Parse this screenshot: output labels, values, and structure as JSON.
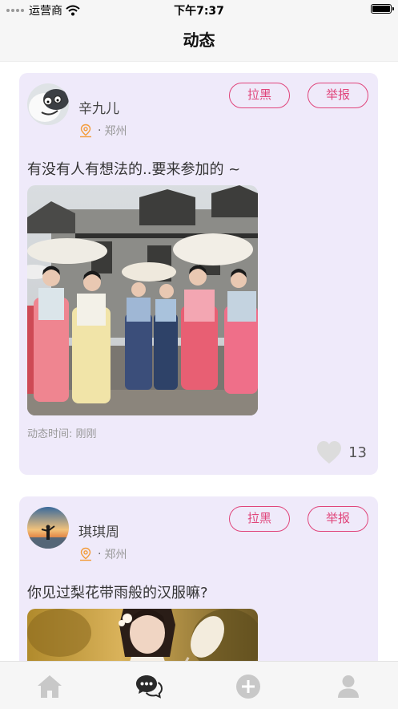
{
  "status_bar": {
    "carrier": "运营商",
    "time": "下午7:37"
  },
  "nav": {
    "title": "动态"
  },
  "posts": [
    {
      "username": "辛九儿",
      "location_separator": "·",
      "location": "郑州",
      "block_label": "拉黑",
      "report_label": "举报",
      "content": "有没有人有想法的..要来参加的 ~",
      "time_label": "动态时间: 刚刚",
      "likes": "13"
    },
    {
      "username": "琪琪周",
      "location_separator": "·",
      "location": "郑州",
      "block_label": "拉黑",
      "report_label": "举报",
      "content": "你见过梨花带雨般的汉服嘛?"
    }
  ],
  "tab_bar": {
    "tabs": [
      {
        "icon": "home-icon",
        "active": false
      },
      {
        "icon": "chat-icon",
        "active": true
      },
      {
        "icon": "add-icon",
        "active": false
      },
      {
        "icon": "profile-icon",
        "active": false
      }
    ]
  },
  "colors": {
    "accent": "#e0457b",
    "card_bg": "#efeafa",
    "pin": "#f39c3a"
  }
}
